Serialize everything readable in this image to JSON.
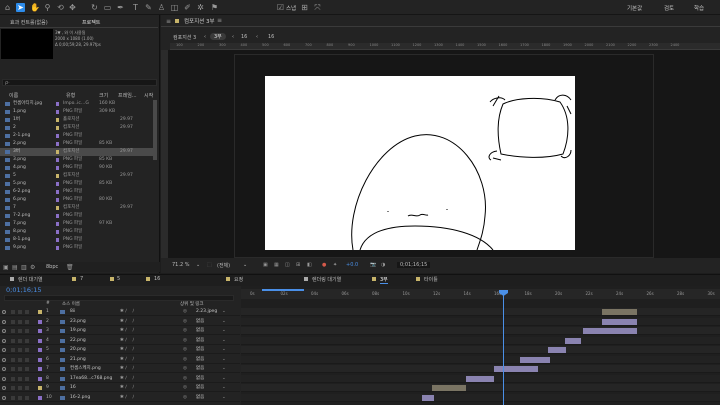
{
  "toolbar": {
    "workspaces": [
      "기본값",
      "검토",
      "학습"
    ],
    "snap_label": "스냅"
  },
  "project": {
    "panel_title": "효과 컨트롤(없음)",
    "tab_label": "프로젝트",
    "info_line1": "3▼ , 와 이 사용됨",
    "info_line2": "2000 x 1080 (1.00)",
    "info_line3": "Δ 0;00;59;28, 29.97fps",
    "search_placeholder": "ρ·",
    "headers": [
      "이름",
      "유형",
      "크기",
      "프레임...",
      "시작"
    ],
    "rows": [
      {
        "name": "컨셉아티치.jpg",
        "type": "Impo..ic…G",
        "size": "160 KB",
        "dur": "",
        "color": "#8a6fc6"
      },
      {
        "name": "1.png",
        "type": "PNG 파일",
        "size": "309 KB",
        "dur": "",
        "color": "#8a6fc6"
      },
      {
        "name": "1버",
        "type": "홀로지션",
        "size": "",
        "dur": "29.97",
        "color": "#c7b46a"
      },
      {
        "name": "2",
        "type": "컴포지션",
        "size": "",
        "dur": "29.97",
        "color": "#c7b46a"
      },
      {
        "name": "2-1.png",
        "type": "PNG 파일",
        "size": "",
        "dur": "",
        "color": "#8a6fc6"
      },
      {
        "name": "2.png",
        "type": "PNG 파일",
        "size": "85 KB",
        "dur": "",
        "color": "#8a6fc6"
      },
      {
        "name": "3버",
        "type": "컴포지션",
        "size": "",
        "dur": "29.97",
        "color": "#c7b46a",
        "selected": true
      },
      {
        "name": "3.png",
        "type": "PNG 파일",
        "size": "85 KB",
        "dur": "",
        "color": "#8a6fc6"
      },
      {
        "name": "4.png",
        "type": "PNG 파일",
        "size": "90 KB",
        "dur": "",
        "color": "#8a6fc6"
      },
      {
        "name": "5",
        "type": "컴포지션",
        "size": "",
        "dur": "29.97",
        "color": "#c7b46a"
      },
      {
        "name": "5.png",
        "type": "PNG 파일",
        "size": "85 KB",
        "dur": "",
        "color": "#8a6fc6"
      },
      {
        "name": "6-2.png",
        "type": "PNG 파일",
        "size": "",
        "dur": "",
        "color": "#8a6fc6"
      },
      {
        "name": "6.png",
        "type": "PNG 파일",
        "size": "80 KB",
        "dur": "",
        "color": "#8a6fc6"
      },
      {
        "name": "7",
        "type": "컴포지션",
        "size": "",
        "dur": "29.97",
        "color": "#c7b46a"
      },
      {
        "name": "7-2.png",
        "type": "PNG 파일",
        "size": "",
        "dur": "",
        "color": "#8a6fc6"
      },
      {
        "name": "7.png",
        "type": "PNG 파일",
        "size": "97 KB",
        "dur": "",
        "color": "#8a6fc6"
      },
      {
        "name": "8.png",
        "type": "PNG 파일",
        "size": "",
        "dur": "",
        "color": "#8a6fc6"
      },
      {
        "name": "8-1.png",
        "type": "PNG 파일",
        "size": "",
        "dur": "",
        "color": "#8a6fc6"
      },
      {
        "name": "9.png",
        "type": "PNG 파일",
        "size": "",
        "dur": "",
        "color": "#8a6fc6"
      }
    ],
    "footer_bpc": "8bpc"
  },
  "comp": {
    "tab_label": "컴포지션 3부",
    "breadcrumbs": [
      "컴포지션 3",
      "3부",
      "16",
      "16"
    ],
    "ruler_labels": [
      "100",
      "200",
      "300",
      "400",
      "500",
      "600",
      "700",
      "800",
      "900",
      "1000",
      "1100",
      "1200",
      "1300",
      "1400",
      "1500",
      "1600",
      "1700",
      "1800",
      "1900",
      "2000",
      "2100",
      "2200",
      "2300",
      "2400"
    ],
    "zoom": "71.2 %",
    "quality": "(전체)",
    "exposure": "+0.0",
    "timecode": "0;01;16;15"
  },
  "timeline": {
    "tabs": [
      {
        "label": "렌더 대기열",
        "color": "#c7b46a"
      },
      {
        "label": "7",
        "color": "#c7b46a"
      },
      {
        "label": "5",
        "color": "#c7b46a"
      },
      {
        "label": "16",
        "color": "#c7b46a"
      },
      {
        "label": "요정",
        "color": "#c7b46a"
      },
      {
        "label": "렌더링 대기열",
        "color": "#aaaaaa"
      },
      {
        "label": "3부",
        "color": "#c7b46a"
      },
      {
        "label": "타이틀",
        "color": "#c7b46a"
      }
    ],
    "current_time": "0;01;16;15",
    "layer_headers": [
      "#",
      "소스 이름",
      "상위 및 링크"
    ],
    "ticks": [
      "0s",
      "02s",
      "04s",
      "06s",
      "08s",
      "10s",
      "12s",
      "14s",
      "16s",
      "18s",
      "20s",
      "22s",
      "24s",
      "26s",
      "28s",
      "30s"
    ],
    "layers": [
      {
        "num": "1",
        "name": "8ii",
        "parent": "2.23.jpeg",
        "color": "#c7b46a"
      },
      {
        "num": "2",
        "name": "23.png",
        "parent": "없음",
        "color": "#8a6fc6"
      },
      {
        "num": "3",
        "name": "19.png",
        "parent": "없음",
        "color": "#8a6fc6"
      },
      {
        "num": "4",
        "name": "22.png",
        "parent": "없음",
        "color": "#8a6fc6"
      },
      {
        "num": "5",
        "name": "20.png",
        "parent": "없음",
        "color": "#8a6fc6"
      },
      {
        "num": "6",
        "name": "21.png",
        "parent": "없음",
        "color": "#8a6fc6"
      },
      {
        "num": "7",
        "name": "컨셉스케치.png",
        "parent": "없음",
        "color": "#8a6fc6"
      },
      {
        "num": "8",
        "name": "17ea68...c768.png",
        "parent": "없음",
        "color": "#8a6fc6"
      },
      {
        "num": "9",
        "name": "16",
        "parent": "없음",
        "color": "#c7b46a"
      },
      {
        "num": "10",
        "name": "16-2.png",
        "parent": "없음",
        "color": "#8a6fc6"
      }
    ]
  }
}
